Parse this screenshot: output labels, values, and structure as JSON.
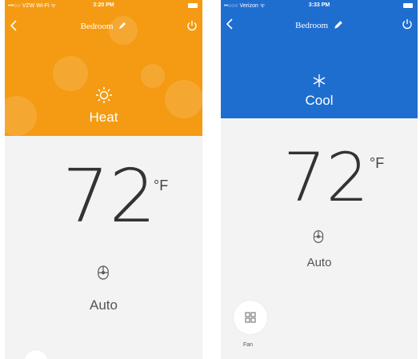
{
  "left_screen": {
    "status_carrier": "•••○○ VZW Wi-Fi ᯤ",
    "status_time": "3:20 PM",
    "room_title": "Bedroom",
    "mode_label": "Heat",
    "temperature": "72",
    "unit": "°F",
    "fan_label": "Auto",
    "header_color": "#f49b13",
    "icons": {
      "back": "chevron-left-icon",
      "edit": "pencil-icon",
      "power": "power-icon",
      "mode": "sun-icon",
      "fan": "fan-icon"
    }
  },
  "right_screen": {
    "status_carrier": "••○○○ Verizon ᯤ",
    "status_time": "3:33 PM",
    "room_title": "Bedroom",
    "mode_label": "Cool",
    "temperature": "72",
    "unit": "°F",
    "fan_label": "Auto",
    "bottom_button_label": "Fan",
    "header_color": "#1e6ed0",
    "icons": {
      "back": "chevron-left-icon",
      "edit": "pencil-icon",
      "power": "power-icon",
      "mode": "snowflake-icon",
      "fan": "fan-icon",
      "bottom": "grid-icon"
    }
  }
}
